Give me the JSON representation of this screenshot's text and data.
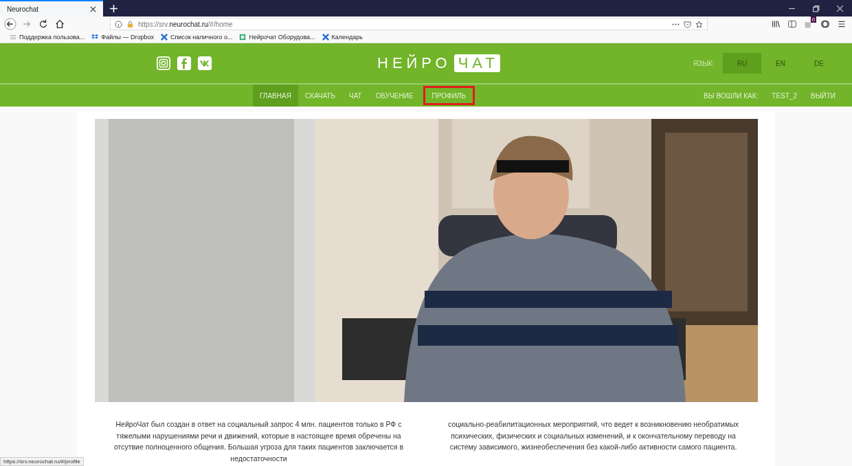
{
  "browser": {
    "tab": {
      "title": "Neurochat"
    },
    "url": {
      "prefix": "https://srv.",
      "domain": "neurochat.ru",
      "path": "/#/home"
    },
    "bookmarks": [
      {
        "label": "Поддержка пользова..."
      },
      {
        "label": "Файлы — Dropbox"
      },
      {
        "label": "Список наличного о..."
      },
      {
        "label": "Нейрочат Оборудова..."
      },
      {
        "label": "Календарь"
      }
    ],
    "badge": "0"
  },
  "header": {
    "logo": {
      "part1": "НЕЙРО",
      "part2": "ЧАТ"
    },
    "language_label": "ЯЗЫК:",
    "languages": [
      {
        "label": "RU",
        "selected": true
      },
      {
        "label": "EN",
        "selected": false
      },
      {
        "label": "DE",
        "selected": false
      }
    ]
  },
  "nav": {
    "items": [
      {
        "label": "ГЛАВНАЯ",
        "selected": true,
        "highlighted": false
      },
      {
        "label": "СКАЧАТЬ",
        "selected": false,
        "highlighted": false
      },
      {
        "label": "ЧАТ",
        "selected": false,
        "highlighted": false
      },
      {
        "label": "ОБУЧЕНИЕ",
        "selected": false,
        "highlighted": false
      },
      {
        "label": "ПРОФИЛЬ",
        "selected": false,
        "highlighted": true
      }
    ],
    "user_label": "ВЫ ВОШЛИ КАК:",
    "user": "TEST_2",
    "logout": "ВЫЙТИ"
  },
  "content": {
    "hero": {
      "kind": "picture"
    },
    "paragraphs": [
      "НейроЧат был создан в ответ на социальный запрос 4 млн. пациентов только в РФ с тяжелыми нарушениями речи и движений, которые в настоящее время обречены на отсутвие полноценного общения. Большая угроза для таких пациентов заключается в недостаточности",
      "социально-реабилитационных мероприятий, что ведет к возникновению необратимых психических, физических и социальных изменений, и к окончательному переводу на систему зависимого, жизнеобеспечения без какой-либо активности самого пациента."
    ]
  },
  "status_bar": {
    "link": "https://srv.neurochat.ru/#/profile"
  }
}
